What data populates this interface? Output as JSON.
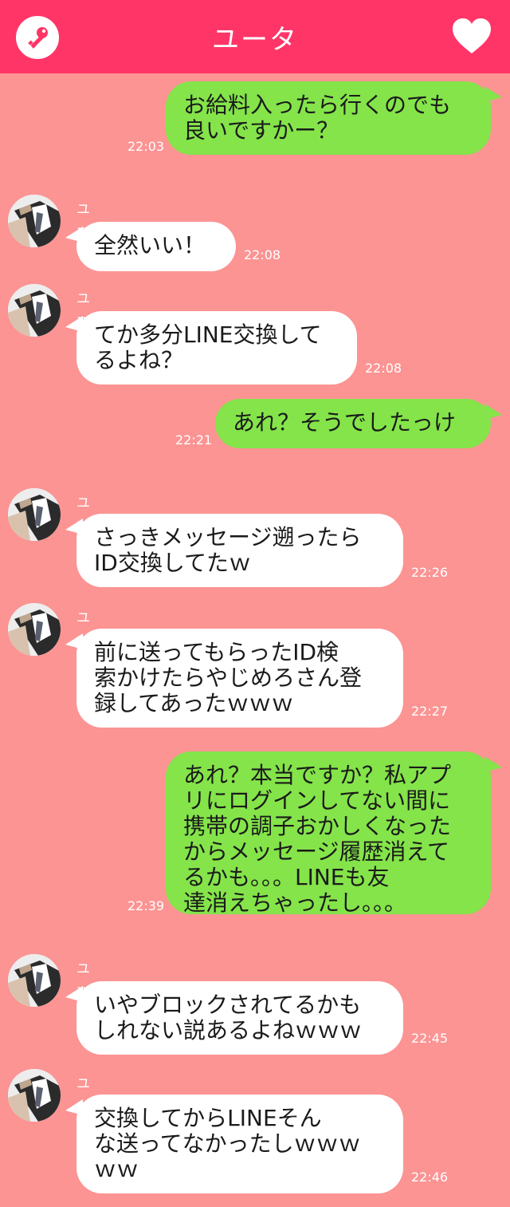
{
  "header": {
    "title": "ユータ",
    "left_icon": "key-icon",
    "right_icon": "heart-icon",
    "accent": "#ff3567"
  },
  "colors": {
    "background": "#fb9493",
    "outgoing_bubble": "#84e44a",
    "incoming_bubble": "#ffffff"
  },
  "messages": [
    {
      "dir": "out",
      "text": "お給料入ったら行くのでも\n良いですかー？",
      "time": "22:03"
    },
    {
      "dir": "in",
      "sender": "ユータ",
      "text": "全然いい！",
      "time": "22:08"
    },
    {
      "dir": "in",
      "sender": "ユータ",
      "text": "てか多分LINE交換して\nるよね？",
      "time": "22:08"
    },
    {
      "dir": "out",
      "text": "あれ？そうでしたっけ",
      "time": "22:21"
    },
    {
      "dir": "in",
      "sender": "ユータ",
      "text": "さっきメッセージ遡ったら\nID交換してたｗ",
      "time": "22:26"
    },
    {
      "dir": "in",
      "sender": "ユータ",
      "text": "前に送ってもらったID検\n索かけたらやじめろさん登\n録してあったｗｗｗ",
      "time": "22:27"
    },
    {
      "dir": "out",
      "text": "あれ？本当ですか？私アプ\nリにログインしてない間に\n携帯の調子おかしくなった\nからメッセージ履歴消えて\nるかも。。。LINEも友\n達消えちゃったし。。。",
      "time": "22:39"
    },
    {
      "dir": "in",
      "sender": "ユータ",
      "text": "いやブロックされてるかも\nしれない説あるよねｗｗｗ",
      "time": "22:45"
    },
    {
      "dir": "in",
      "sender": "ユータ",
      "text": "交換してからLINEそん\nな送ってなかったしｗｗｗ\nｗｗ",
      "time": "22:46"
    }
  ]
}
